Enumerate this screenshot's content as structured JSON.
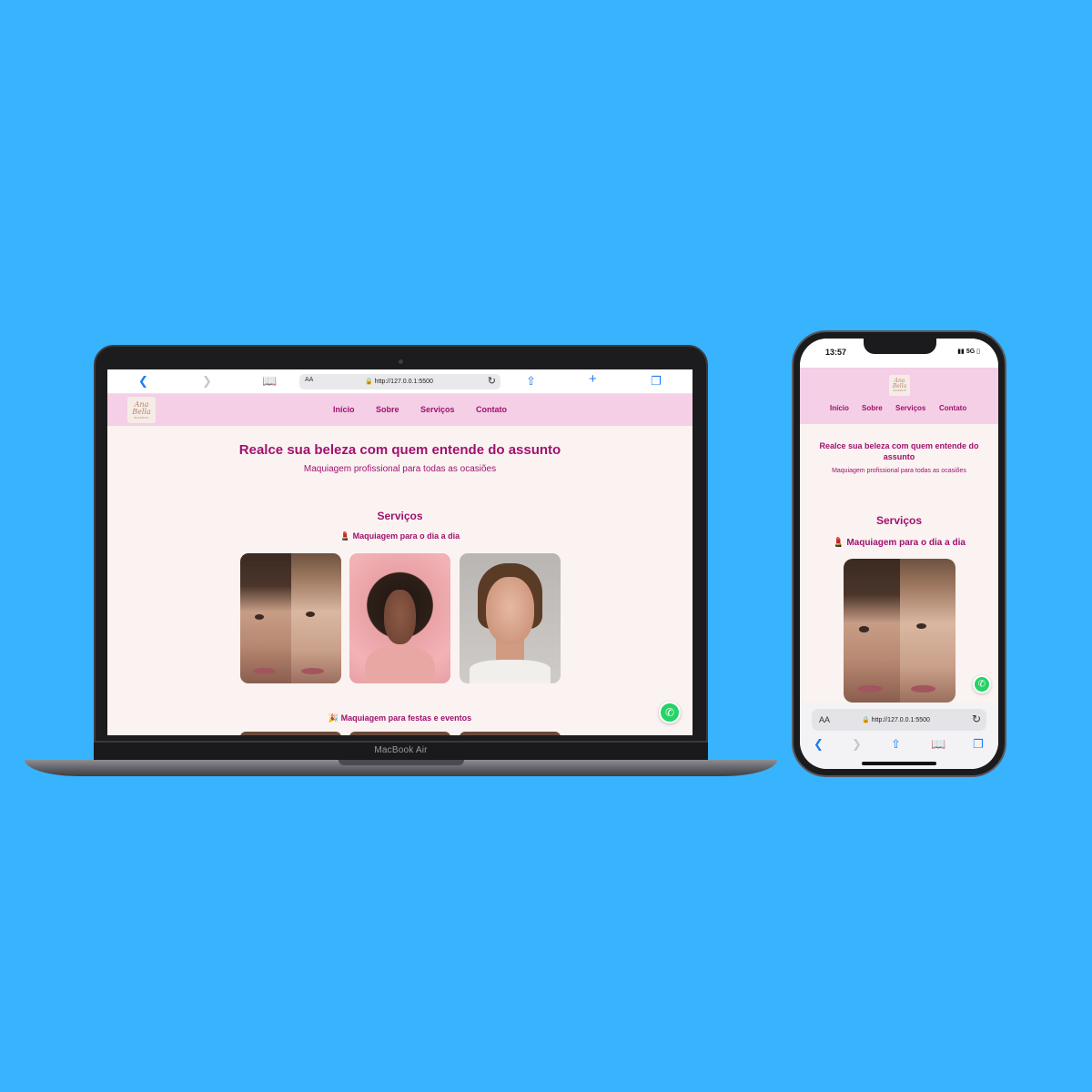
{
  "laptop": {
    "device_label": "MacBook Air",
    "browser": {
      "address_aa": "AA",
      "url": "http://127.0.0.1:5500",
      "icons": [
        "chevron-left-icon",
        "chevron-right-icon",
        "book-icon",
        "lock-icon",
        "reload-icon",
        "share-icon",
        "plus-icon",
        "tabs-icon"
      ]
    }
  },
  "phone": {
    "status": {
      "time": "13:57",
      "signal": "5G"
    },
    "browser": {
      "address_aa": "AA",
      "url": "http://127.0.0.1:5500"
    }
  },
  "site": {
    "logo": {
      "line1": "Ana",
      "line2": "Bella",
      "line3": "MAKEUP"
    },
    "nav": [
      "Início",
      "Sobre",
      "Serviços",
      "Contato"
    ],
    "hero": {
      "title": "Realce sua beleza com quem entende do assunto",
      "subtitle": "Maquiagem profissional para todas as ocasiões"
    },
    "services": {
      "title": "Serviços",
      "categories": [
        {
          "icon": "lipstick-icon",
          "label": "Maquiagem para o dia a dia"
        },
        {
          "icon": "party-popper-icon",
          "label": "Maquiagem para festas e eventos"
        }
      ]
    },
    "whatsapp_button": "whatsapp-icon"
  },
  "colors": {
    "background": "#38b3fe",
    "accent": "#a0116e",
    "nav_bg": "#f4cfe6",
    "page_bg": "#faf3f1",
    "whatsapp": "#25d366"
  }
}
